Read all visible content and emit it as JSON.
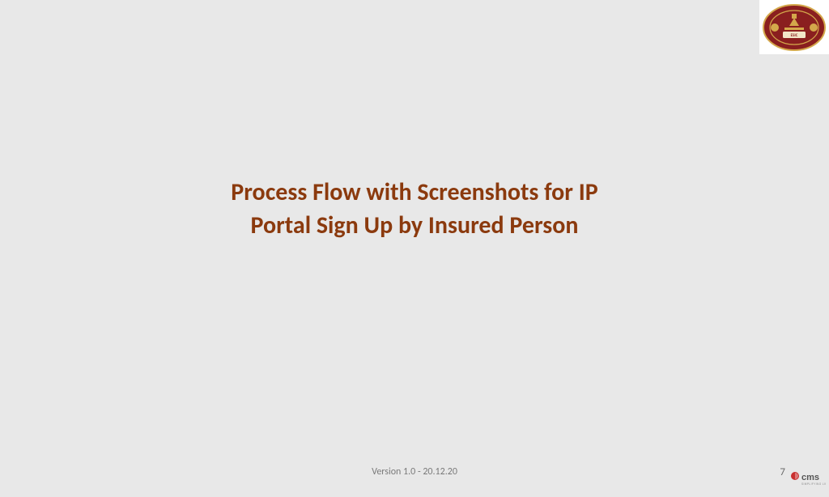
{
  "header": {
    "logo_name": "ESIC"
  },
  "title": {
    "line1": "Process Flow with Screenshots for IP",
    "line2": "Portal Sign Up by Insured Person"
  },
  "footer": {
    "version": "Version 1.0 - 20.12.20",
    "page": "7",
    "brand": "cms"
  }
}
